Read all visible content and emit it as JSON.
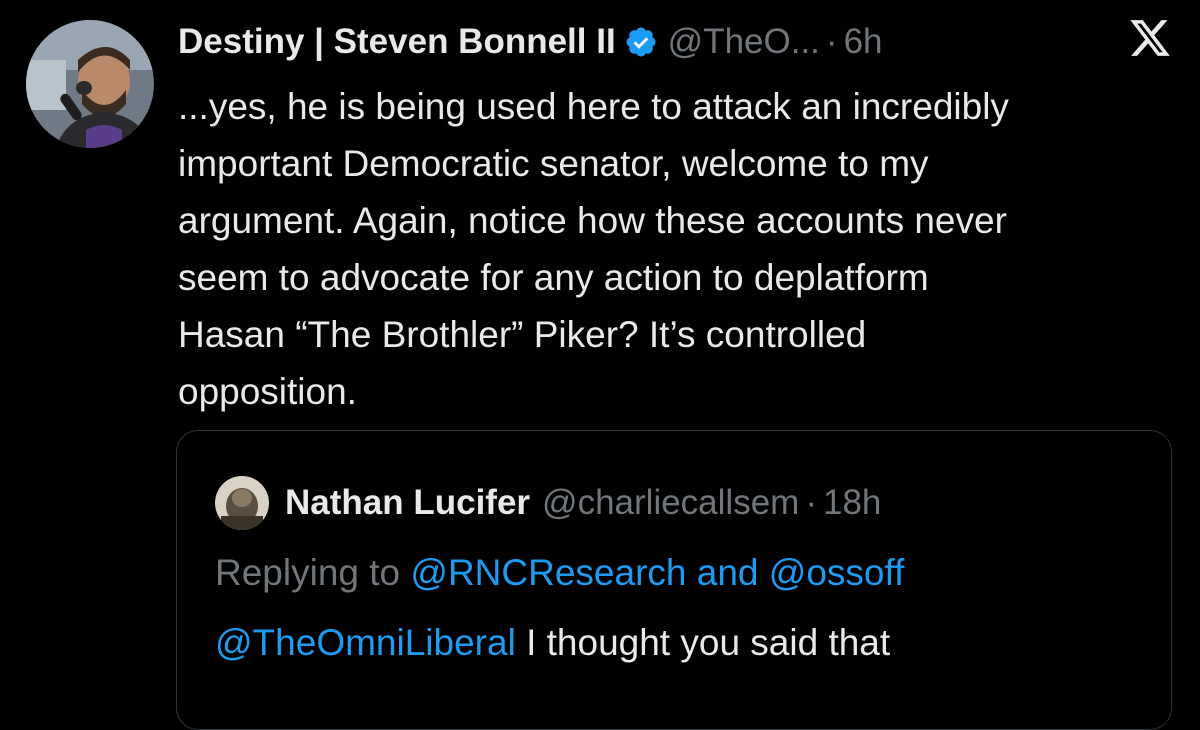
{
  "tweet": {
    "author": {
      "display_name": "Destiny | Steven Bonnell II",
      "handle": "@TheO...",
      "separator": "·",
      "time": "6h",
      "verified": true,
      "avatar_icon": "profile-photo"
    },
    "platform_icon": "x-logo-icon",
    "body_lines": [
      "...yes, he is being used here to attack an incredibly",
      "important Democratic senator, welcome to my",
      "argument. Again, notice how these accounts never",
      "seem to advocate for any action to deplatform",
      "Hasan “The Brothler” Piker? It’s controlled",
      "opposition."
    ]
  },
  "quoted_tweet": {
    "author": {
      "display_name": "Nathan Lucifer",
      "handle": "@charliecallsem",
      "separator": "·",
      "time": "18h",
      "avatar_icon": "profile-photo"
    },
    "reply_prefix": "Replying to",
    "reply_mentions": "@RNCResearch and @ossoff",
    "body_mention": "@TheOmniLiberal",
    "body_text": " I thought you said that"
  },
  "colors": {
    "background": "#000000",
    "text": "#e7e9ea",
    "muted": "#71767b",
    "link": "#1d9bf0",
    "verified": "#1d9bf0",
    "border": "#2f3336"
  }
}
